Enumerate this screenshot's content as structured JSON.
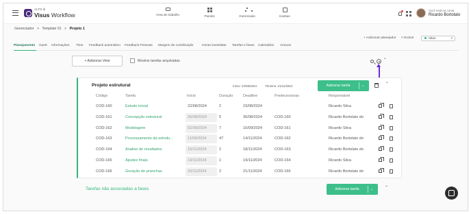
{
  "brand": {
    "small": "ALTO di",
    "name_bold": "Visus",
    "name_light": " Workflow"
  },
  "nav": [
    {
      "label": "Área de trabalho",
      "icon": "monitor-icon"
    },
    {
      "label": "Painéis",
      "icon": "grid-icon"
    },
    {
      "label": "Gerenciado",
      "icon": "hierarchy-icon"
    },
    {
      "label": "Kanban",
      "icon": "kanban-icon"
    }
  ],
  "account": {
    "caption": "Você está na conta",
    "name": "Ricardo Bortolato"
  },
  "breadcrumb": {
    "items": [
      "Gerenciador",
      ">",
      "Template 01",
      ">"
    ],
    "current": "Projeto 1"
  },
  "header_actions": {
    "add_planner": "+ Adicionar planejador",
    "delete": "Excluir",
    "status": "Ativo"
  },
  "tabs": [
    "Planejamento",
    "Gantt",
    "Informações",
    "Time",
    "Feedback automático",
    "Feedback Pessoas",
    "Margem de contribuição",
    "Horas investidas",
    "Tarefas e fases",
    "Calendário",
    "Anexos"
  ],
  "toolbar": {
    "add_view": "+ Adicionar View",
    "archived_label": "Mostrar tarefas arquivadas"
  },
  "phase": {
    "title": "Projeto estrutural",
    "start": "Início: 22/08/2024",
    "end": "Término: 21/11/2024",
    "add_task": "Adicionar tarefa",
    "columns": [
      "Código",
      "Tarefa",
      "Início",
      "Duração",
      "Deadline",
      "Predecessoras",
      "Responsável"
    ],
    "rows": [
      {
        "code": "COD-160",
        "task": "Estudo inicial",
        "start": "22/08/2024",
        "duration": "2",
        "deadline": "23/08/2024",
        "pred": "",
        "owner": "Ricardo Silva",
        "start_filled": false
      },
      {
        "code": "COD-161",
        "task": "Concepção estrutural",
        "start": "26/08/2024",
        "duration": "5",
        "deadline": "30/08/2024",
        "pred": "COD-160",
        "owner": "Ricardo Bortolato do",
        "start_filled": true
      },
      {
        "code": "COD-162",
        "task": "Modelagem",
        "start": "02/09/2024",
        "duration": "7",
        "deadline": "10/09/2024",
        "pred": "COD-161",
        "owner": "Ricardo Silva",
        "start_filled": true
      },
      {
        "code": "COD-163",
        "task": "Processamento da estrutu...",
        "start": "11/09/2024",
        "duration": "47",
        "deadline": "14/11/2024",
        "pred": "COD-162",
        "owner": "Ricardo Bortolato do",
        "start_filled": true
      },
      {
        "code": "COD-164",
        "task": "Analise de resultados",
        "start": "15/11/2024",
        "duration": "2",
        "deadline": "18/11/2024",
        "pred": "COD-163",
        "owner": "Ricardo Bortolato do",
        "start_filled": true
      },
      {
        "code": "COD-165",
        "task": "Ajustes finais",
        "start": "19/11/2024",
        "duration": "1",
        "deadline": "19/11/2024",
        "pred": "COD-164",
        "owner": "Ricardo Silva",
        "start_filled": true
      },
      {
        "code": "COD-166",
        "task": "Geração de pranchas",
        "start": "20/11/2024",
        "duration": "2",
        "deadline": "21/11/2024",
        "pred": "COD-165",
        "owner": "Ricardo Bortolato do",
        "start_filled": true
      }
    ]
  },
  "unassociated": {
    "title": "Tarefas não associadas a fases",
    "add_task": "Adicionar tarefa"
  },
  "colors": {
    "accent": "#3dbf8a",
    "accent_text": "#2fa36e",
    "annotation": "#6a2bd9"
  }
}
